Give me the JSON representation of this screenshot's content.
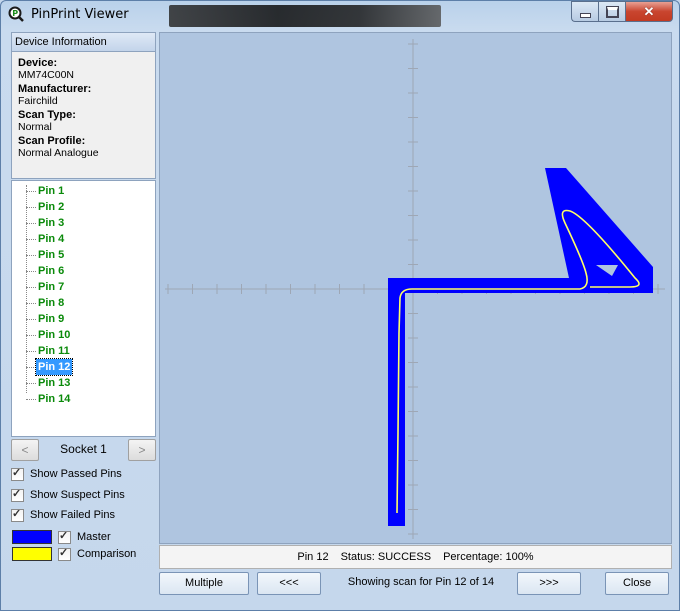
{
  "window": {
    "title": "PinPrint Viewer"
  },
  "device_info": {
    "header": "Device Information",
    "device_label": "Device:",
    "device_value": "MM74C00N",
    "manufacturer_label": "Manufacturer:",
    "manufacturer_value": "Fairchild",
    "scan_type_label": "Scan Type:",
    "scan_type_value": "Normal",
    "scan_profile_label": "Scan Profile:",
    "scan_profile_value": "Normal Analogue"
  },
  "pins": [
    "Pin 1",
    "Pin 2",
    "Pin 3",
    "Pin 4",
    "Pin 5",
    "Pin 6",
    "Pin 7",
    "Pin 8",
    "Pin 9",
    "Pin 10",
    "Pin 11",
    "Pin 12",
    "Pin 13",
    "Pin 14"
  ],
  "selected_pin_index": 11,
  "socket": {
    "prev": "<",
    "label": "Socket 1",
    "next": ">"
  },
  "checks": {
    "show_passed": "Show Passed Pins",
    "show_suspect": "Show Suspect Pins",
    "show_failed": "Show Failed Pins",
    "master": "Master",
    "comparison": "Comparison"
  },
  "colors": {
    "master": "#0000ff",
    "comparison": "#ffff00",
    "pin_text": "#0a8a0a"
  },
  "status": {
    "pin": "Pin 12",
    "status": "Status: SUCCESS",
    "percentage": "Percentage: 100%"
  },
  "buttons": {
    "multiple": "Multiple",
    "prev": "<<<",
    "next": ">>>",
    "close": "Close"
  },
  "scan_label": "Showing scan for Pin 12 of 14"
}
